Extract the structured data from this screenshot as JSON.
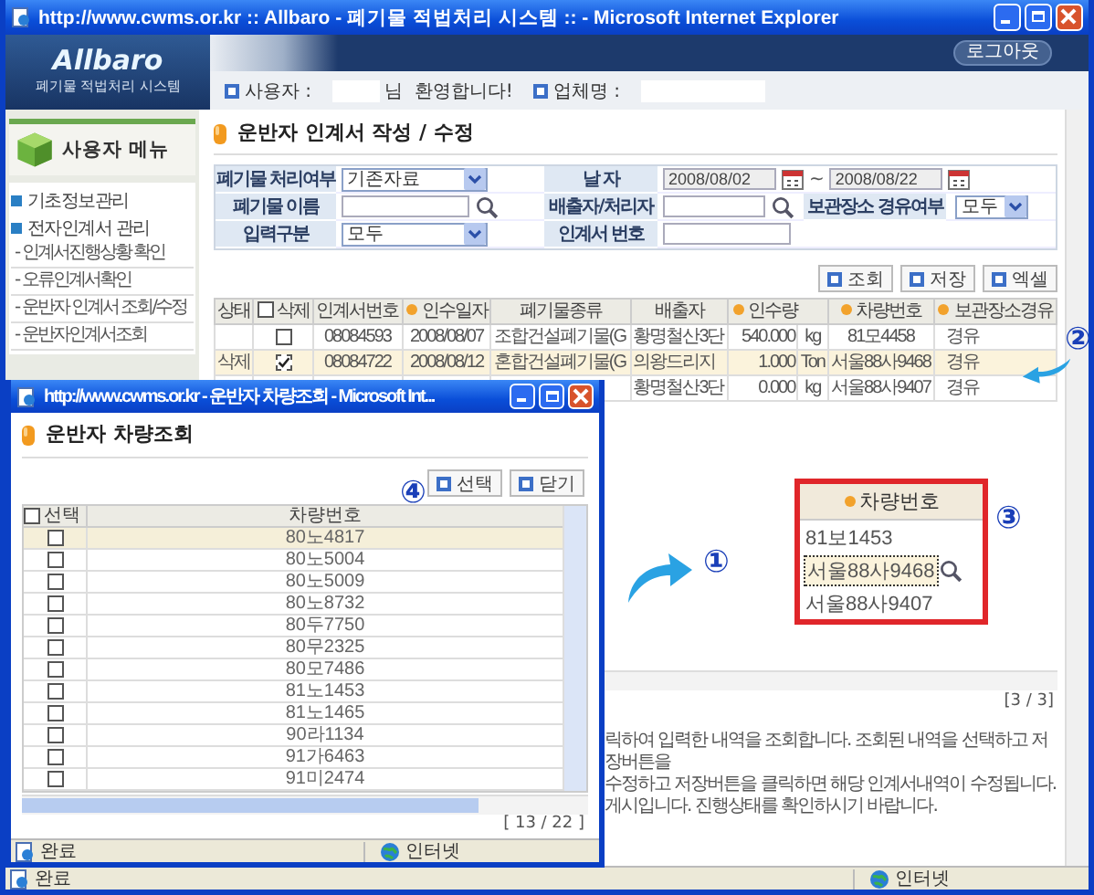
{
  "window": {
    "title": "http://www.cwms.or.kr :: Allbaro - 폐기물 적법처리 시스템 :: - Microsoft Internet Explorer"
  },
  "header": {
    "logo": "Allbaro",
    "subtitle": "폐기물 적법처리 시스템",
    "logout": "로그아웃",
    "user_label": "사용자 :",
    "greeting": "님  환영합니다!",
    "company_label": "업체명 :"
  },
  "sidebar": {
    "title": "사용자 메뉴",
    "items": [
      {
        "label": "기초정보관리"
      },
      {
        "label": "전자인계서 관리",
        "children": [
          {
            "label": "- 인계서진행상황 확인"
          },
          {
            "label": "- 오류인계서확인"
          },
          {
            "label": "- 운반자 인계서 조회/수정"
          },
          {
            "label": "- 운반자인계서조회"
          }
        ]
      }
    ]
  },
  "page_title": "운반자 인계서 작성 / 수정",
  "form": [
    {
      "label": "폐기물 처리여부",
      "controls": [
        {
          "kind": "select",
          "value": "기존자료"
        }
      ]
    },
    {
      "label": "날 자",
      "controls": [
        {
          "kind": "date",
          "value": "2008/08/02"
        },
        {
          "kind": "text",
          "text": "~"
        },
        {
          "kind": "date",
          "value": "2008/08/22"
        }
      ]
    },
    {
      "label": "폐기물 이름",
      "controls": [
        {
          "kind": "input"
        },
        {
          "kind": "lookup"
        }
      ]
    },
    {
      "label": "배출자/처리자",
      "controls": [
        {
          "kind": "input"
        },
        {
          "kind": "lookup"
        },
        {
          "kind": "label",
          "text": "보관장소 경유여부"
        },
        {
          "kind": "select",
          "value": "모두"
        }
      ]
    },
    {
      "label": "입력구분",
      "controls": [
        {
          "kind": "select",
          "value": "모두"
        }
      ]
    },
    {
      "label": "인계서 번호",
      "controls": [
        {
          "kind": "input"
        }
      ]
    }
  ],
  "actions": [
    "조회",
    "저장",
    "엑셀"
  ],
  "results": {
    "columns": [
      {
        "label": "상태"
      },
      {
        "label": "삭제",
        "kind": "checkbox",
        "checked": false
      },
      {
        "label": "인계서번호"
      },
      {
        "label": "인수일자",
        "required": true
      },
      {
        "label": "폐기물종류"
      },
      {
        "label": "배출자"
      },
      {
        "label": "인수량",
        "required": true,
        "kind": "quantity"
      },
      {
        "kind": "unit"
      },
      {
        "label": "차량번호",
        "required": true
      },
      {
        "label": "보관장소경유",
        "required": true
      }
    ],
    "rows": [
      {
        "selected": false,
        "delete_checked": false,
        "cells": [
          "",
          "",
          "08084593",
          "2008/08/07",
          "조합건설폐기물(G",
          "황명철산3단",
          "540.000",
          "kg",
          "81모4458",
          "경유"
        ]
      },
      {
        "selected": true,
        "delete_checked": true,
        "cells": [
          "삭제",
          "",
          "08084722",
          "2008/08/12",
          "혼합건설폐기물(G",
          "의왕드리지",
          "1.000",
          "Ton",
          "서울88사9468",
          "경유"
        ]
      },
      {
        "selected": false,
        "cells": [
          null,
          null,
          null,
          null,
          null,
          "황명철산3단",
          "0.000",
          "kg",
          "서울88사9407",
          "경유"
        ]
      }
    ]
  },
  "pager": "[3 / 3]",
  "help": [
    "릭하여 입력한 내역을 조회합니다. 조회된 내역을 선택하고 저장버튼을",
    "수정하고 저장버튼을 클릭하면 해당 인계서내역이 수정됩니다.",
    "게시입니다. 진행상태를 확인하시기 바랍니다."
  ],
  "callout": {
    "header": "차량번호",
    "values": [
      {
        "text": "81보1453",
        "focused": false
      },
      {
        "text": "서울88사9468",
        "focused": true
      },
      {
        "text": "서울88사9407",
        "focused": false
      }
    ]
  },
  "annotations": [
    "①",
    "②",
    "③",
    "④"
  ],
  "status_bar": {
    "text": "완료",
    "zone": "인터넷"
  },
  "popup": {
    "title": "http://www.cwms.or.kr - 운반자 차량조회 - Microsoft Int...",
    "heading": "운반자 차량조회",
    "actions": [
      "선택",
      "닫기"
    ],
    "columns": [
      {
        "label": "선택",
        "kind": "checkbox",
        "checked": false
      },
      {
        "label": "차량번호"
      }
    ],
    "rows": [
      {
        "vehicle": "80노4817",
        "checked": false,
        "selected": true
      },
      {
        "vehicle": "80노5004",
        "checked": false,
        "selected": false
      },
      {
        "vehicle": "80노5009",
        "checked": false,
        "selected": false
      },
      {
        "vehicle": "80노8732",
        "checked": false,
        "selected": false
      },
      {
        "vehicle": "80두7750",
        "checked": false,
        "selected": false
      },
      {
        "vehicle": "80무2325",
        "checked": false,
        "selected": false
      },
      {
        "vehicle": "80모7486",
        "checked": false,
        "selected": false
      },
      {
        "vehicle": "81노1453",
        "checked": false,
        "selected": false
      },
      {
        "vehicle": "81노1465",
        "checked": false,
        "selected": false
      },
      {
        "vehicle": "90라1134",
        "checked": false,
        "selected": false
      },
      {
        "vehicle": "91가6463",
        "checked": false,
        "selected": false
      },
      {
        "vehicle": "91미2474",
        "checked": false,
        "selected": false
      }
    ],
    "pager": "[ 13 / 22 ]",
    "status_bar": {
      "text": "완료",
      "zone": "인터넷"
    }
  }
}
